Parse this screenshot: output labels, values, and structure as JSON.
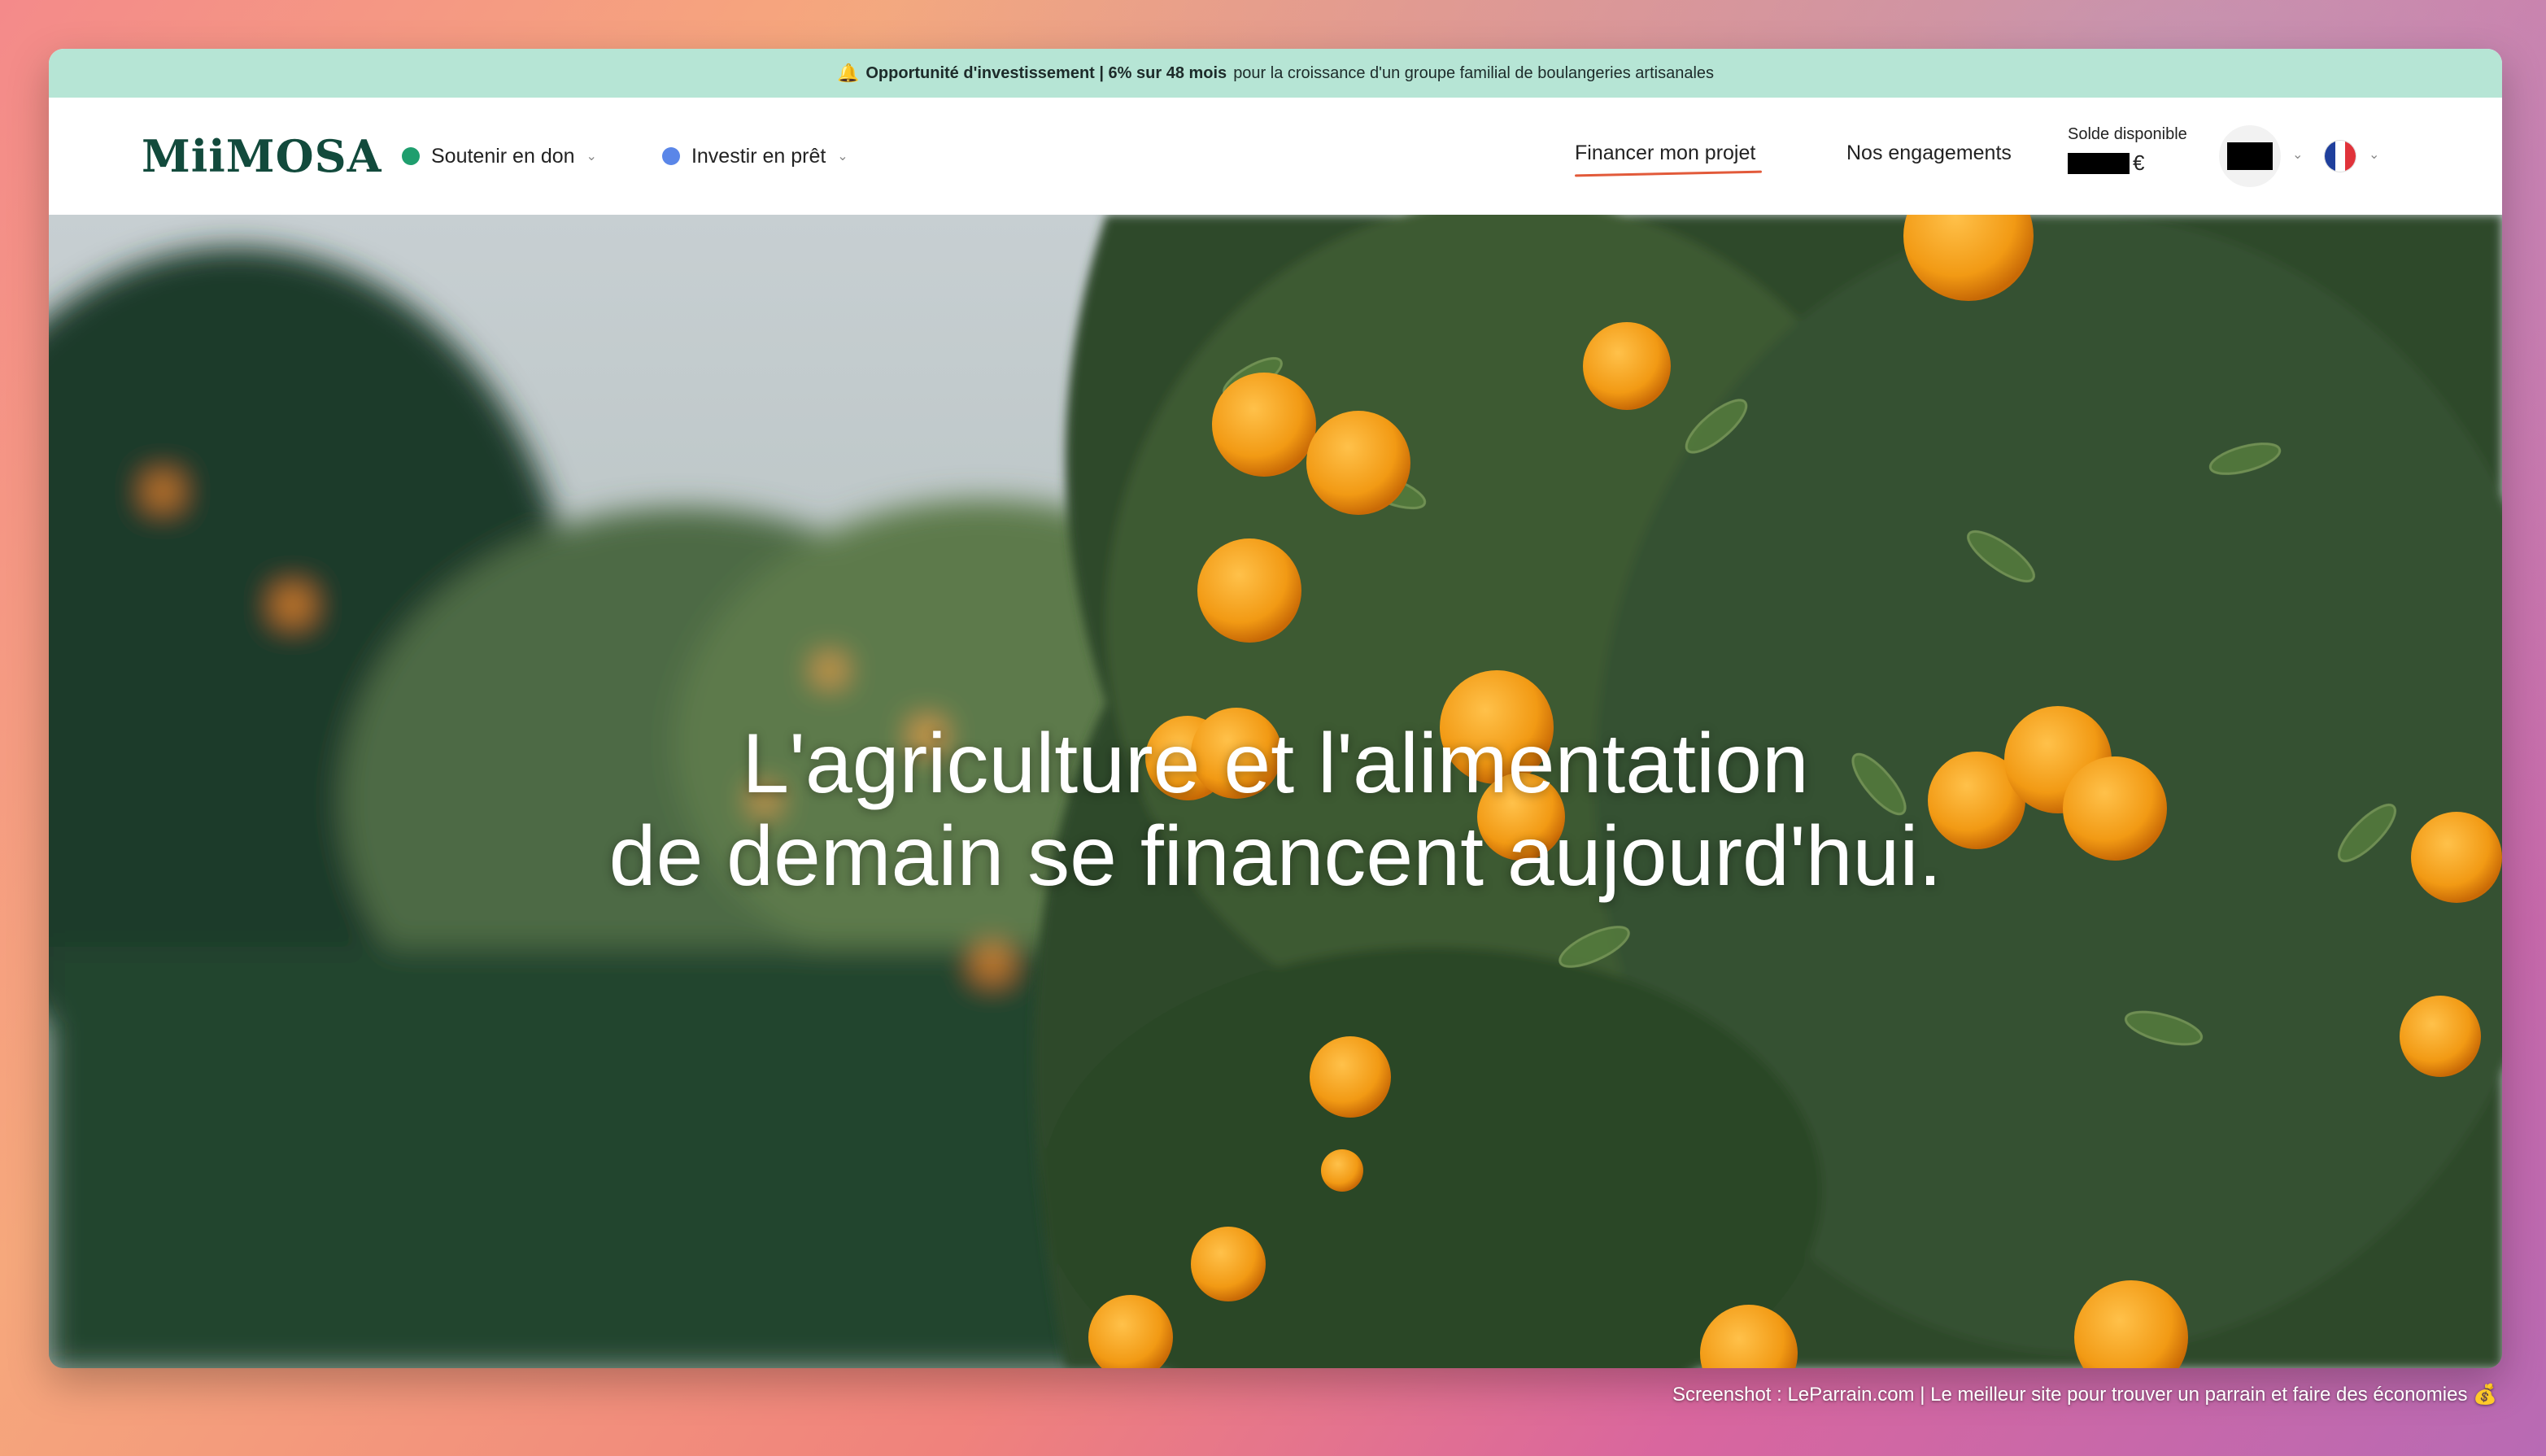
{
  "banner": {
    "icon": "bell-icon",
    "bold_text": "Opportunité d'investissement | 6% sur 48 mois",
    "text": "pour la croissance d'un groupe familial de boulangeries artisanales"
  },
  "header": {
    "logo": "MiiMOSA",
    "nav": [
      {
        "label": "Soutenir en don",
        "dot_color": "#1f9e6e"
      },
      {
        "label": "Investir en prêt",
        "dot_color": "#5a86e8"
      }
    ],
    "links": {
      "finance": "Financer mon projet",
      "engagements": "Nos engagements"
    },
    "balance": {
      "label": "Solde disponible",
      "currency": "€"
    },
    "language_flag": "fr-flag-icon"
  },
  "hero": {
    "line1": "L'agriculture et l'alimentation",
    "line2": "de demain se financent aujourd'hui."
  },
  "footer": {
    "credit": "Screenshot : LeParrain.com | Le meilleur site pour trouver un parrain et faire des économies 💰"
  },
  "colors": {
    "banner_bg": "#b6e5d5",
    "logo": "#124a3c",
    "accent_underline": "#e25a3a"
  }
}
